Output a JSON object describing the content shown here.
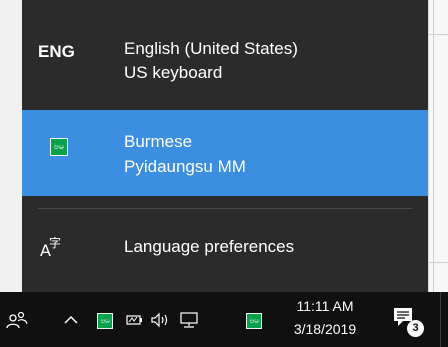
{
  "flyout": {
    "languages": [
      {
        "code": "ENG",
        "name": "English (United States)",
        "layout": "US keyboard",
        "selected": false
      },
      {
        "icon": "ime-green-icon",
        "icon_text": "ဗမ",
        "name": "Burmese",
        "layout": "Pyidaungsu MM",
        "selected": true
      }
    ],
    "preferences_label": "Language preferences",
    "preferences_icon": "language-preferences-icon"
  },
  "taskbar": {
    "ime_text": "ဗမ",
    "time": "11:11 AM",
    "date": "3/18/2019",
    "notification_count": "3",
    "icons": [
      "people-icon",
      "chevron-up-icon",
      "ime-icon",
      "battery-icon",
      "volume-icon",
      "network-icon",
      "ime-icon",
      "notifications-icon"
    ]
  },
  "colors": {
    "flyout_bg": "#2b2b2b",
    "selected_bg": "#3b8ee0",
    "taskbar_bg": "#101010",
    "ime_green": "#0aa14d"
  }
}
